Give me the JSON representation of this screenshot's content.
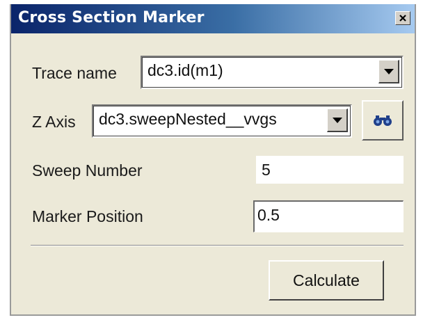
{
  "window": {
    "title": "Cross Section Marker",
    "close_glyph": "×"
  },
  "form": {
    "trace_name": {
      "label": "Trace name",
      "value": "dc3.id(m1)"
    },
    "z_axis": {
      "label": "Z Axis",
      "value": "dc3.sweepNested__vvgs",
      "find_icon": "binoculars-icon"
    },
    "sweep_number": {
      "label": "Sweep Number",
      "value": "5"
    },
    "marker_position": {
      "label": "Marker Position",
      "value": "0.5"
    }
  },
  "actions": {
    "calculate_label": "Calculate"
  },
  "colors": {
    "titlebar_start": "#0a246a",
    "titlebar_end": "#a6caf0",
    "dialog_bg": "#ece9d8",
    "binoculars": "#1f3f8a"
  }
}
